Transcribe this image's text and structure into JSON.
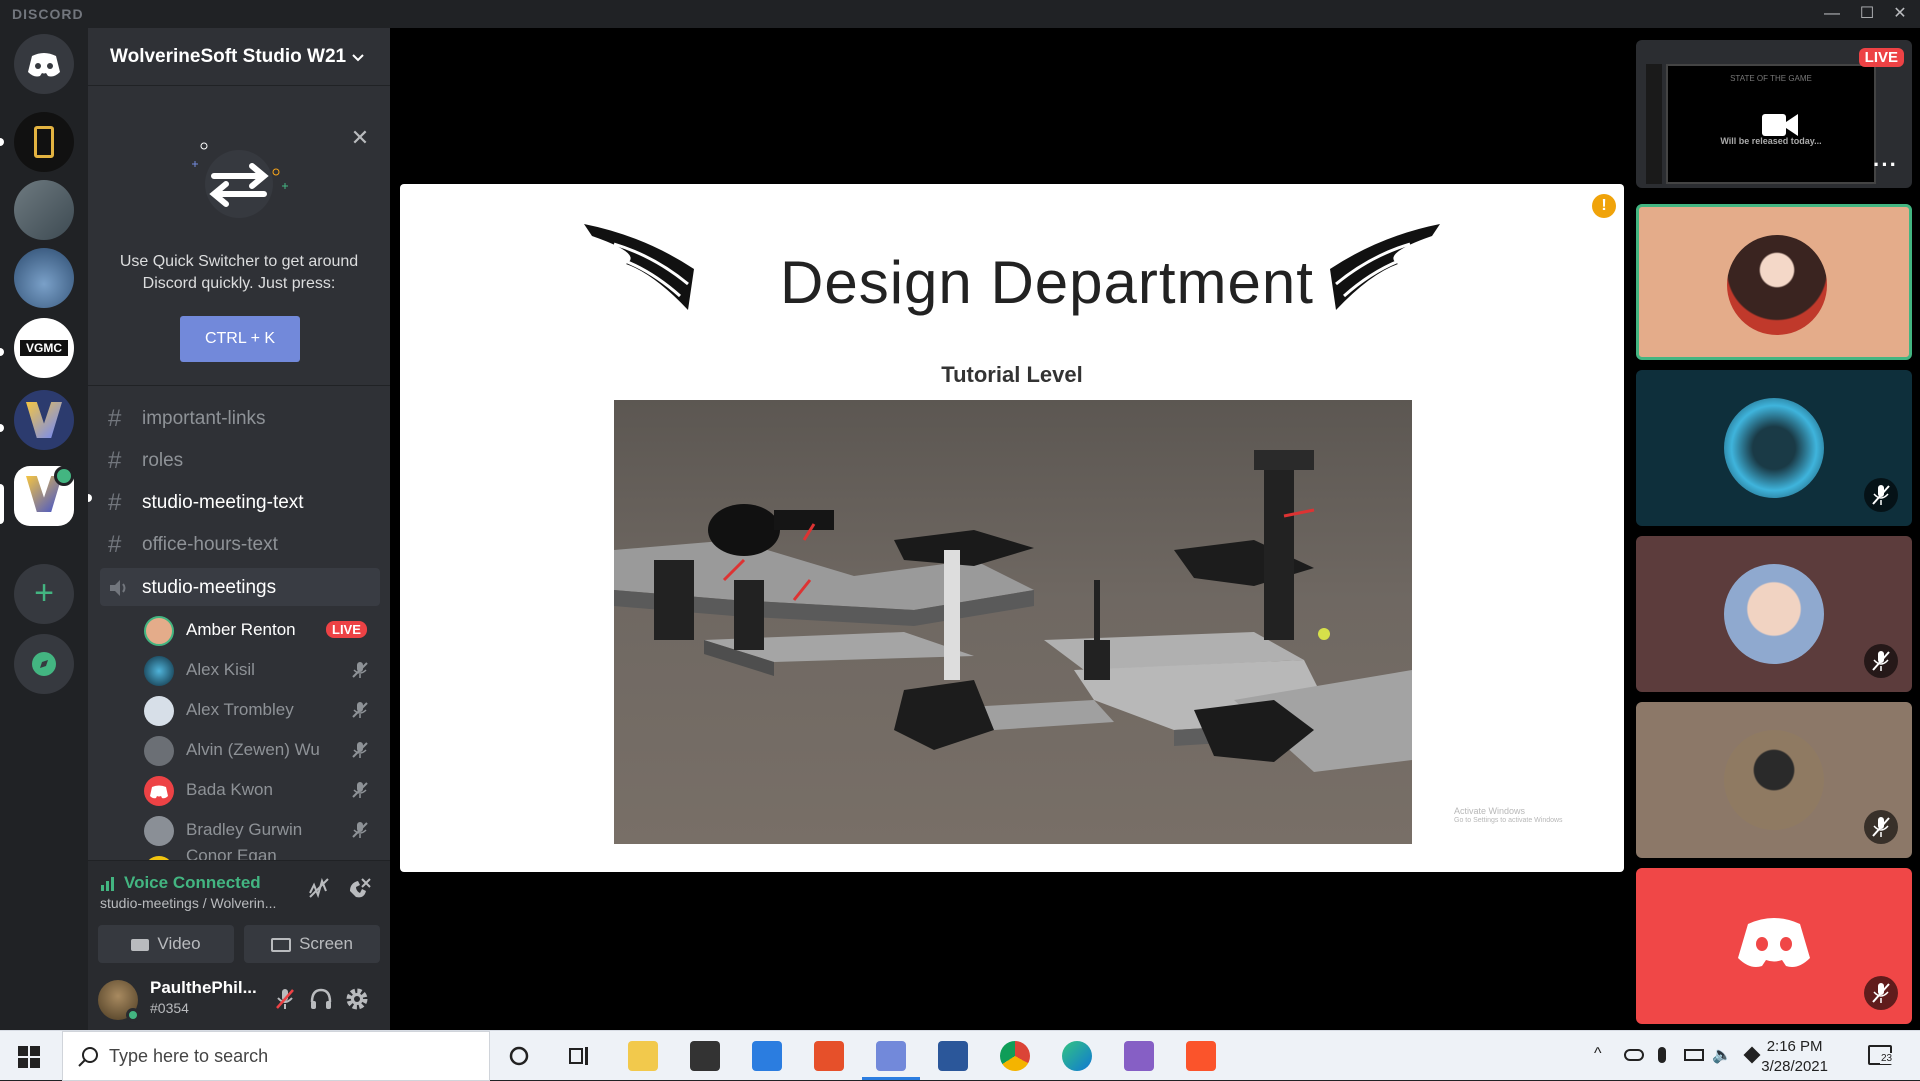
{
  "app": {
    "brand": "DISCORD"
  },
  "window_controls": {
    "minimize": "—",
    "maximize": "☐",
    "close": "✕"
  },
  "server": {
    "name": "WolverineSoft Studio W21"
  },
  "quick_switcher": {
    "text": "Use Quick Switcher to get around Discord quickly. Just press:",
    "shortcut": "CTRL + K"
  },
  "channels": [
    {
      "name": "important-links"
    },
    {
      "name": "roles"
    },
    {
      "name": "studio-meeting-text"
    },
    {
      "name": "office-hours-text"
    }
  ],
  "voice_channel": {
    "name": "studio-meetings"
  },
  "voice_users": [
    {
      "name": "Amber Renton",
      "badge": "LIVE"
    },
    {
      "name": "Alex Kisil"
    },
    {
      "name": "Alex Trombley"
    },
    {
      "name": "Alvin (Zewen) Wu"
    },
    {
      "name": "Bada Kwon"
    },
    {
      "name": "Bradley Gurwin"
    },
    {
      "name": "Conor Egan"
    }
  ],
  "voice_status": {
    "title": "Voice Connected",
    "subtitle": "studio-meetings / Wolverin...",
    "video_label": "Video",
    "screen_label": "Screen"
  },
  "user": {
    "name": "PaulthePhil...",
    "tag": "#0354"
  },
  "slide": {
    "title": "Design Department",
    "subtitle": "Tutorial Level",
    "watermark_line1": "Activate Windows",
    "watermark_line2": "Go to Settings to activate Windows"
  },
  "tiles": {
    "live_label": "LIVE",
    "mini_title": "STATE OF THE GAME",
    "mini_text": "Will be released today..."
  },
  "taskbar": {
    "search_placeholder": "Type here to search",
    "time": "2:16 PM",
    "date": "3/28/2021",
    "notifications": "23"
  },
  "colors": {
    "accent": "#7289da",
    "live": "#ed4245",
    "voice_green": "#43b581",
    "tile_highlight": "#e4ac8a"
  }
}
